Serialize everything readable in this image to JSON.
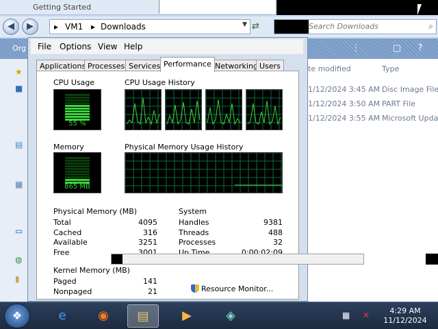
{
  "explorer": {
    "title_fragment": "Getting Started",
    "breadcrumb": [
      "VM1",
      "Downloads"
    ],
    "search_placeholder": "Search Downloads",
    "toolbar_label": "Org",
    "columns": {
      "modified": "te modified",
      "type": "Type"
    },
    "files": [
      {
        "modified": "1/12/2024 3:45 AM",
        "type": "Disc Image File"
      },
      {
        "modified": "1/12/2024 3:50 AM",
        "type": "PART File"
      },
      {
        "modified": "1/12/2024 3:55 AM",
        "type": "Microsoft Upda"
      }
    ]
  },
  "taskmgr": {
    "menu": [
      "File",
      "Options",
      "View",
      "Help"
    ],
    "tabs": [
      "Applications",
      "Processes",
      "Services",
      "Performance",
      "Networking",
      "Users"
    ],
    "active_tab": "Performance",
    "cpu_usage_label": "CPU Usage",
    "cpu_history_label": "CPU Usage History",
    "cpu_percent_text": "55 %",
    "cpu_percent": 55,
    "memory_label": "Memory",
    "memory_history_label": "Physical Memory Usage History",
    "memory_text": "865 MB",
    "memory_fraction": 0.21,
    "physical_memory": {
      "title": "Physical Memory (MB)",
      "rows": [
        {
          "label": "Total",
          "value": "4095"
        },
        {
          "label": "Cached",
          "value": "316"
        },
        {
          "label": "Available",
          "value": "3251"
        },
        {
          "label": "Free",
          "value": "3001"
        }
      ]
    },
    "system": {
      "title": "System",
      "rows": [
        {
          "label": "Handles",
          "value": "9381"
        },
        {
          "label": "Threads",
          "value": "488"
        },
        {
          "label": "Processes",
          "value": "32"
        },
        {
          "label": "Up Time",
          "value": "0:00:02:09"
        }
      ]
    },
    "kernel_memory": {
      "title": "Kernel Memory (MB)",
      "rows": [
        {
          "label": "Paged",
          "value": "141"
        },
        {
          "label": "Nonpaged",
          "value": "21"
        }
      ]
    },
    "resource_monitor_label": "Resource Monitor..."
  },
  "taskbar": {
    "apps": [
      "ie-icon",
      "firefox-icon",
      "explorer-icon",
      "media-player-icon",
      "app-icon"
    ],
    "time": "4:29 AM",
    "date": "11/12/2024"
  },
  "colors": {
    "graph_green": "#3cd43c",
    "graph_grid": "#0d6b3a",
    "desktop_blue": "#3a6fb5"
  }
}
